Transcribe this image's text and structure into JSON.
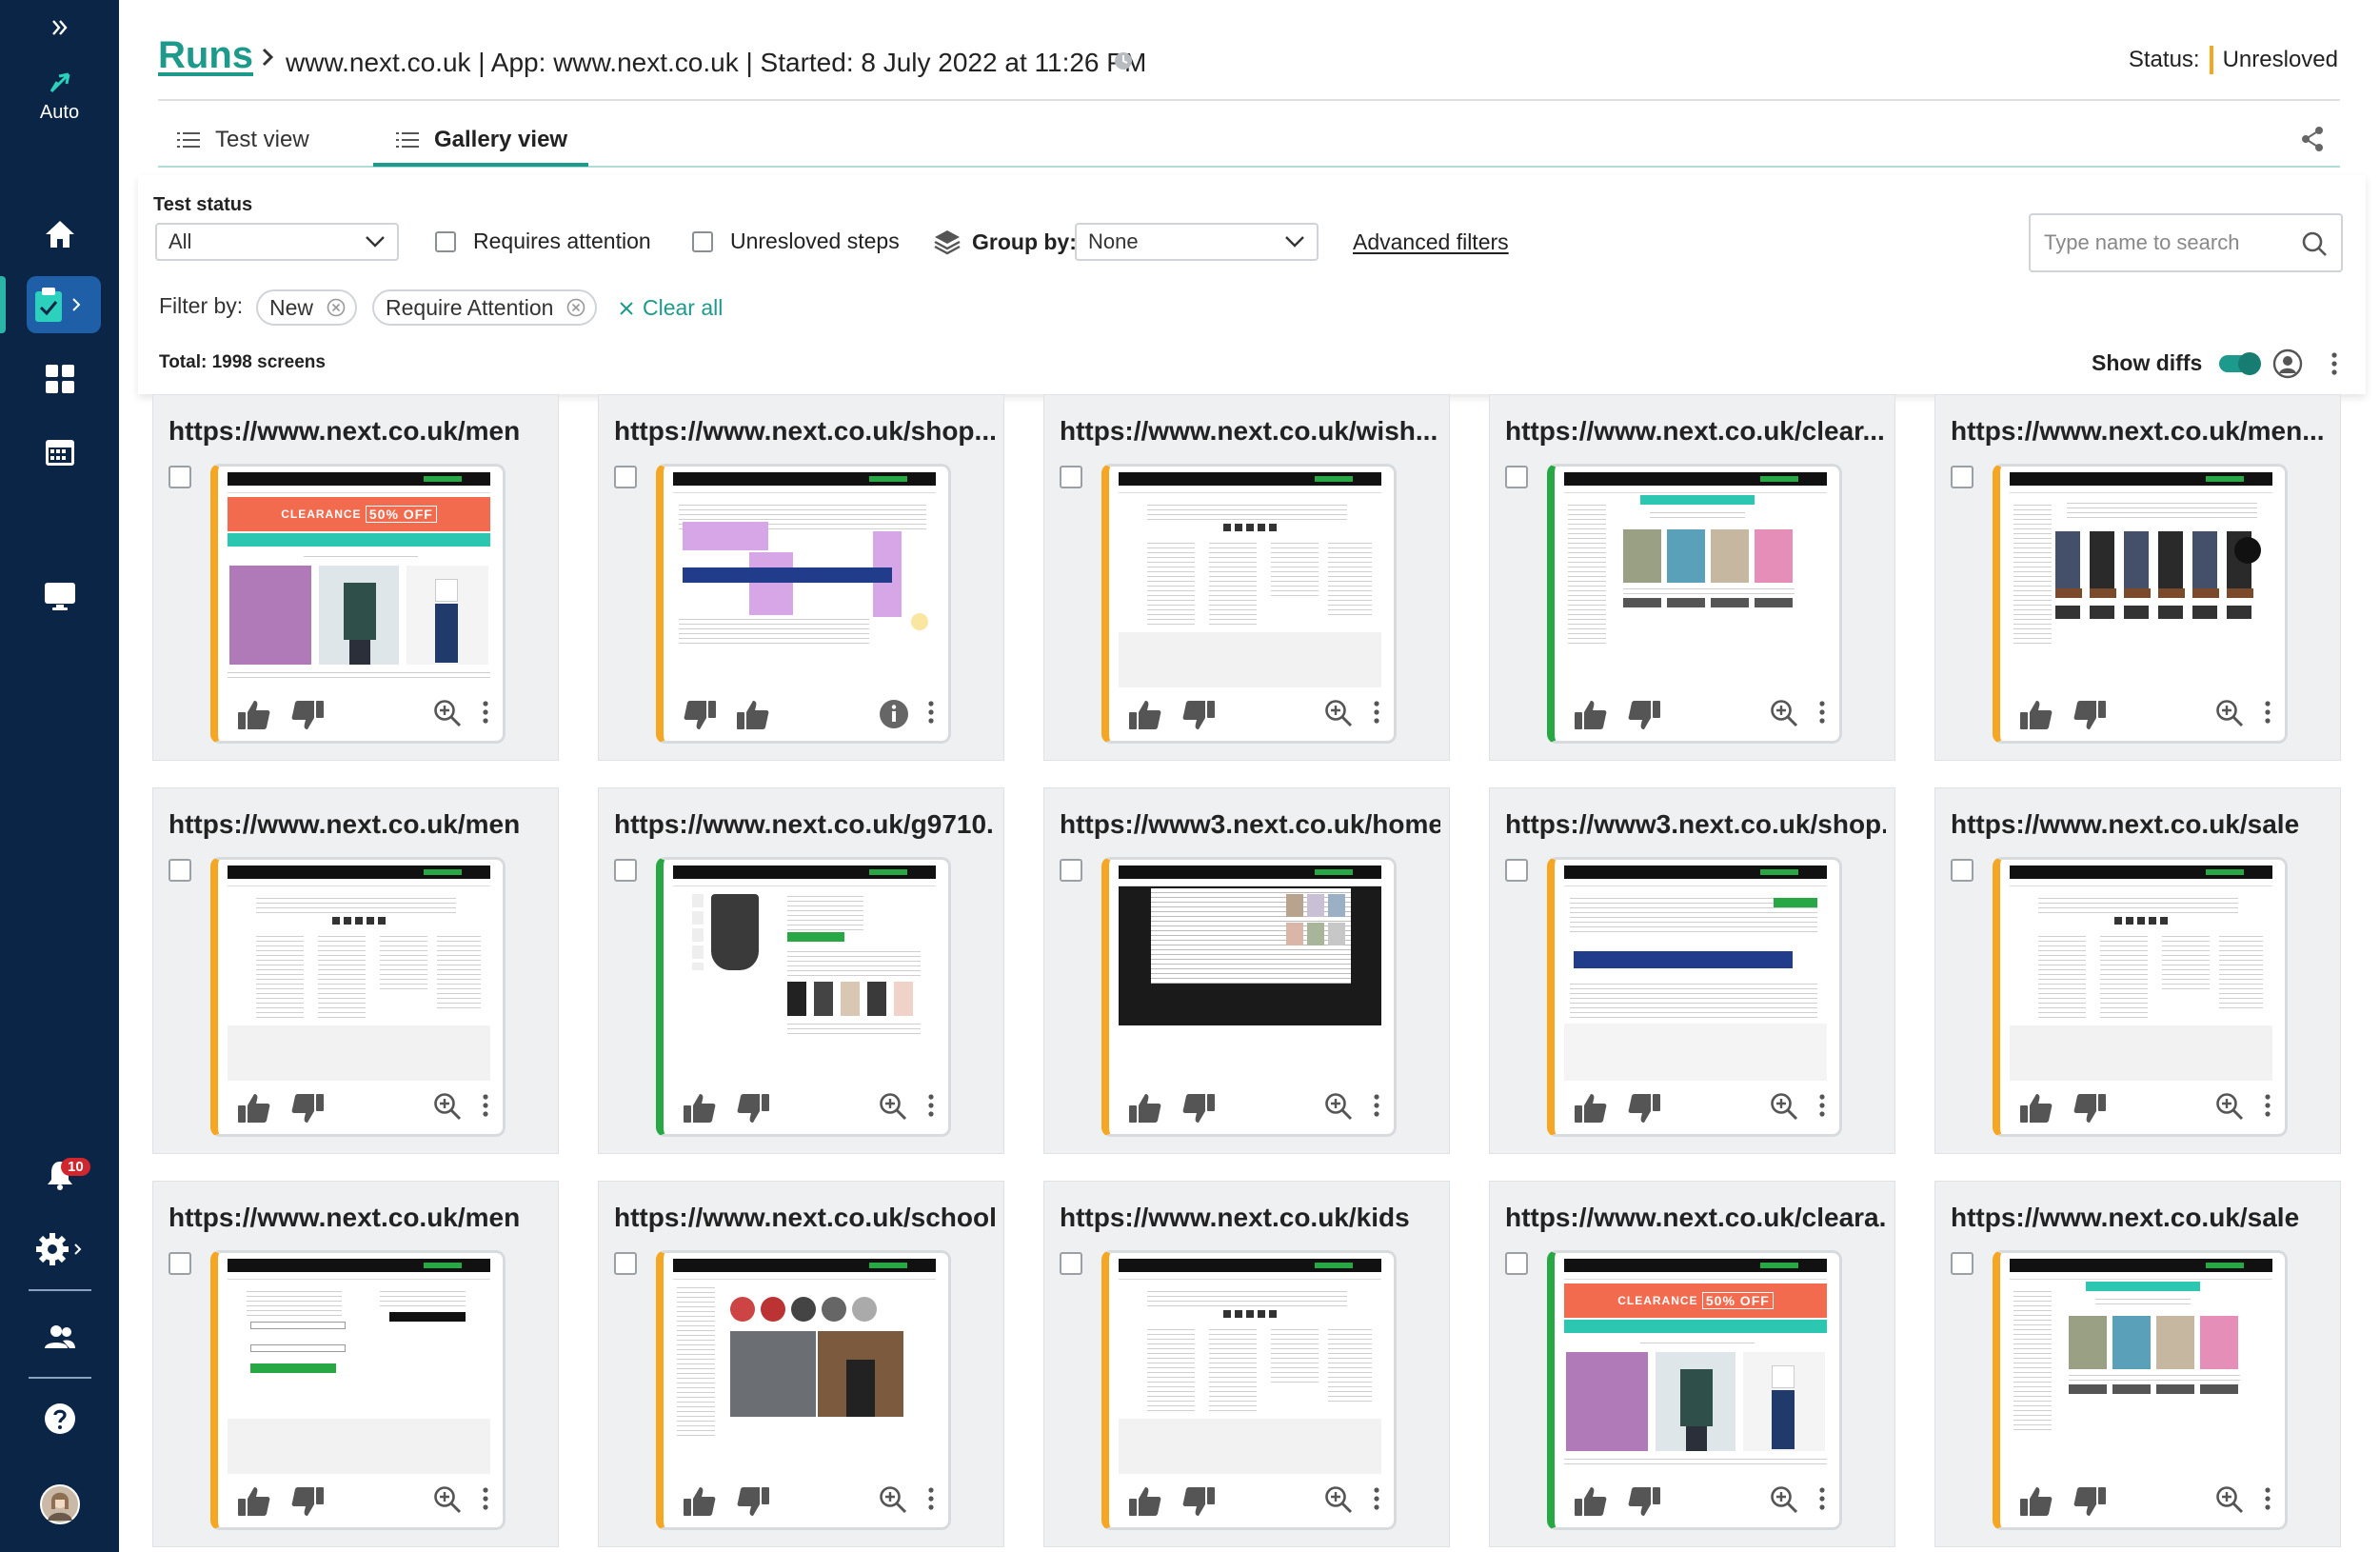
{
  "sidebar": {
    "auto_label": "Auto",
    "notification_count": "10"
  },
  "header": {
    "runs_label": "Runs",
    "breadcrumb": "www.next.co.uk  | App: www.next.co.uk | Started: 8 July 2022 at 11:26 PM",
    "status_label": "Status:",
    "status_value": "Unresloved",
    "status_color": "#f5a623"
  },
  "tabs": [
    {
      "label": "Test view"
    },
    {
      "label": "Gallery view"
    }
  ],
  "filters": {
    "test_status_label": "Test status",
    "test_status_value": "All",
    "requires_attention_label": "Requires attention",
    "unresolved_steps_label": "Unresloved steps",
    "group_by_label": "Group by:",
    "group_by_value": "None",
    "advanced_filters_label": "Advanced filters",
    "search_placeholder": "Type name to search",
    "filter_by_label": "Filter by:",
    "chips": [
      "New",
      "Require Attention"
    ],
    "clear_all_label": "Clear all",
    "total_label": "Total: 1998  screens",
    "show_diffs_label": "Show diffs"
  },
  "accent_color": "#1d9a8c",
  "cards": [
    {
      "title": "https://www.next.co.uk/men",
      "status": "orange",
      "thumb": "clearance",
      "inverted": false
    },
    {
      "title": "https://www.next.co.uk/shop...",
      "status": "orange",
      "thumb": "diff",
      "inverted": true
    },
    {
      "title": "https://www.next.co.uk/wish...",
      "status": "orange",
      "thumb": "footer",
      "inverted": false
    },
    {
      "title": "https://www.next.co.uk/clear...",
      "status": "green",
      "thumb": "products",
      "inverted": false
    },
    {
      "title": "https://www.next.co.uk/men...",
      "status": "orange",
      "thumb": "shoes",
      "inverted": false
    },
    {
      "title": "https://www.next.co.uk/men",
      "status": "orange",
      "thumb": "footer",
      "inverted": false
    },
    {
      "title": "https://www.next.co.uk/g9710...",
      "status": "green",
      "thumb": "dress",
      "inverted": false
    },
    {
      "title": "https://www3.next.co.uk/home",
      "status": "orange",
      "thumb": "dark",
      "inverted": false
    },
    {
      "title": "https://www3.next.co.uk/shop...",
      "status": "orange",
      "thumb": "bag",
      "inverted": false
    },
    {
      "title": "https://www.next.co.uk/sale",
      "status": "orange",
      "thumb": "footer",
      "inverted": false
    },
    {
      "title": "https://www.next.co.uk/men",
      "status": "orange",
      "thumb": "login",
      "inverted": false
    },
    {
      "title": "https://www.next.co.uk/school",
      "status": "orange",
      "thumb": "school",
      "inverted": false
    },
    {
      "title": "https://www.next.co.uk/kids",
      "status": "orange",
      "thumb": "footer",
      "inverted": false
    },
    {
      "title": "https://www.next.co.uk/cleara...",
      "status": "green",
      "thumb": "clearance",
      "inverted": false
    },
    {
      "title": "https://www.next.co.uk/sale",
      "status": "orange",
      "thumb": "products",
      "inverted": false
    }
  ],
  "thumb_text": {
    "clearance": "CLEARANCE",
    "off": "50% OFF"
  }
}
